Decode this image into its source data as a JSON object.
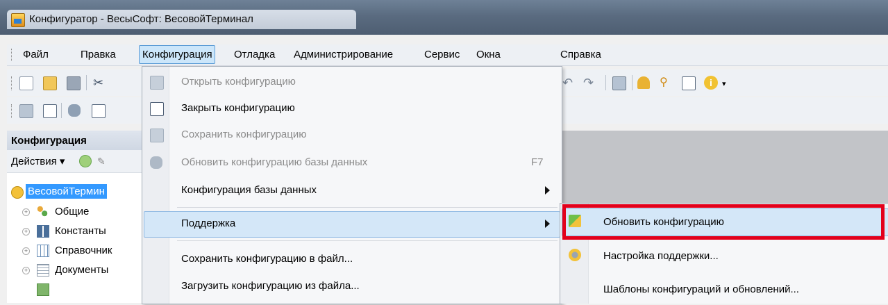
{
  "window": {
    "title": "Конфигуратор - ВесыСофт: ВесовойТерминал"
  },
  "menubar": {
    "items": [
      {
        "label": "Файл"
      },
      {
        "label": "Правка"
      },
      {
        "label": "Конфигурация",
        "active": true
      },
      {
        "label": "Отладка"
      },
      {
        "label": "Администрирование"
      },
      {
        "label": "Сервис"
      },
      {
        "label": "Окна"
      },
      {
        "label": "Справка"
      }
    ]
  },
  "config_menu": {
    "items": [
      {
        "label": "Открыть конфигурацию",
        "disabled": true,
        "icon": "open-config-icon"
      },
      {
        "label": "Закрыть конфигурацию",
        "disabled": false,
        "icon": "close-config-icon"
      },
      {
        "label": "Сохранить конфигурацию",
        "disabled": true,
        "icon": "save-config-icon"
      },
      {
        "label": "Обновить конфигурацию базы данных",
        "disabled": true,
        "shortcut": "F7",
        "icon": "database-update-icon"
      },
      {
        "label": "Конфигурация базы данных",
        "submenu": true
      },
      {
        "label": "Поддержка",
        "submenu": true,
        "hover": true
      },
      {
        "label": "Сохранить конфигурацию в файл..."
      },
      {
        "label": "Загрузить конфигурацию из файла..."
      }
    ]
  },
  "support_submenu": {
    "items": [
      {
        "label": "Обновить конфигурацию",
        "icon": "update-config-icon",
        "hover": true
      },
      {
        "label": "Настройка поддержки...",
        "icon": "support-settings-icon"
      },
      {
        "label": "Шаблоны конфигураций и обновлений..."
      }
    ]
  },
  "panel": {
    "title": "Конфигурация",
    "actions_label": "Действия",
    "tree": [
      {
        "label": "ВесовойТермин",
        "icon": "config-root-icon",
        "selected": true
      },
      {
        "label": "Общие",
        "icon": "common-icon"
      },
      {
        "label": "Константы",
        "icon": "constants-icon"
      },
      {
        "label": "Справочник",
        "icon": "catalogs-icon"
      },
      {
        "label": "Документы",
        "icon": "documents-icon"
      }
    ]
  },
  "colors": {
    "highlight": "#e3001b",
    "menu_hover": "#d4e7f8",
    "tree_selected": "#3399ff"
  }
}
